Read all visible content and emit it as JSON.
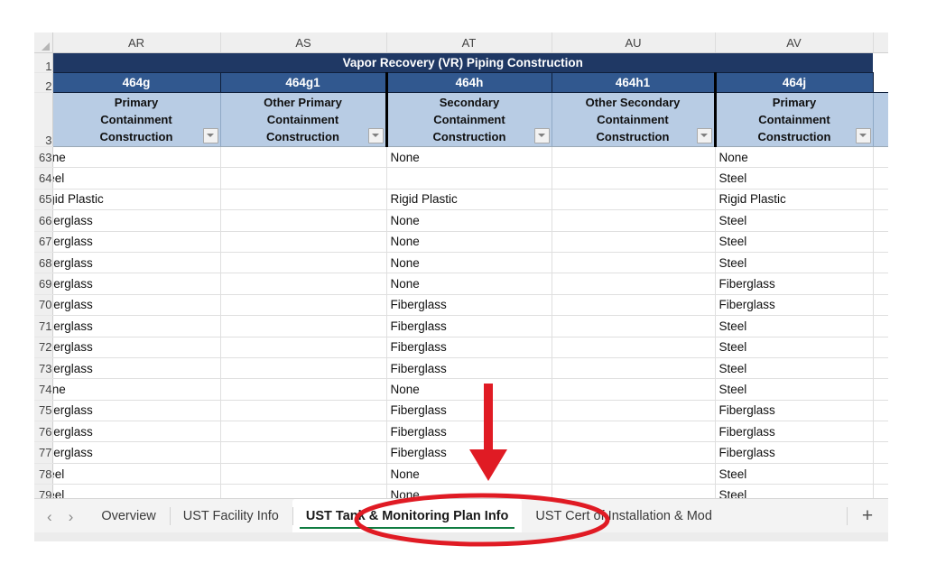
{
  "spreadsheet": {
    "corner_label": "select-all",
    "column_headers": [
      "AR",
      "AS",
      "AT",
      "AU",
      "AV"
    ],
    "title_row": {
      "row_number": "1",
      "text": "Vapor Recovery (VR) Piping Construction"
    },
    "code_row": {
      "row_number": "2",
      "codes": [
        "464g",
        "464g1",
        "464h",
        "464h1",
        "464j"
      ]
    },
    "label_row": {
      "row_number": "3",
      "labels": [
        [
          "Primary",
          "Containment",
          "Construction"
        ],
        [
          "Other Primary",
          "Containment",
          "Construction"
        ],
        [
          "Secondary",
          "Containment",
          "Construction"
        ],
        [
          "Other Secondary",
          "Containment",
          "Construction"
        ],
        [
          "Primary",
          "Containment",
          "Construction"
        ]
      ],
      "filter_icon": "filter-dropdown-icon"
    },
    "rows": [
      {
        "n": "63",
        "AR": "None",
        "AS": "",
        "AT": "None",
        "AU": "",
        "AV": "None"
      },
      {
        "n": "64",
        "AR": "Steel",
        "AS": "",
        "AT": "",
        "AU": "",
        "AV": "Steel"
      },
      {
        "n": "65",
        "AR": "Rigid Plastic",
        "AS": "",
        "AT": "Rigid Plastic",
        "AU": "",
        "AV": "Rigid Plastic"
      },
      {
        "n": "66",
        "AR": "Fiberglass",
        "AS": "",
        "AT": "None",
        "AU": "",
        "AV": "Steel"
      },
      {
        "n": "67",
        "AR": "Fiberglass",
        "AS": "",
        "AT": "None",
        "AU": "",
        "AV": "Steel"
      },
      {
        "n": "68",
        "AR": "Fiberglass",
        "AS": "",
        "AT": "None",
        "AU": "",
        "AV": "Steel"
      },
      {
        "n": "69",
        "AR": "Fiberglass",
        "AS": "",
        "AT": "None",
        "AU": "",
        "AV": "Fiberglass"
      },
      {
        "n": "70",
        "AR": "Fiberglass",
        "AS": "",
        "AT": "Fiberglass",
        "AU": "",
        "AV": "Fiberglass"
      },
      {
        "n": "71",
        "AR": "Fiberglass",
        "AS": "",
        "AT": "Fiberglass",
        "AU": "",
        "AV": "Steel"
      },
      {
        "n": "72",
        "AR": "Fiberglass",
        "AS": "",
        "AT": "Fiberglass",
        "AU": "",
        "AV": "Steel"
      },
      {
        "n": "73",
        "AR": "Fiberglass",
        "AS": "",
        "AT": "Fiberglass",
        "AU": "",
        "AV": "Steel"
      },
      {
        "n": "74",
        "AR": "None",
        "AS": "",
        "AT": "None",
        "AU": "",
        "AV": "Steel"
      },
      {
        "n": "75",
        "AR": "Fiberglass",
        "AS": "",
        "AT": "Fiberglass",
        "AU": "",
        "AV": "Fiberglass"
      },
      {
        "n": "76",
        "AR": "Fiberglass",
        "AS": "",
        "AT": "Fiberglass",
        "AU": "",
        "AV": "Fiberglass"
      },
      {
        "n": "77",
        "AR": "Fiberglass",
        "AS": "",
        "AT": "Fiberglass",
        "AU": "",
        "AV": "Fiberglass"
      },
      {
        "n": "78",
        "AR": "Steel",
        "AS": "",
        "AT": "None",
        "AU": "",
        "AV": "Steel"
      },
      {
        "n": "79",
        "AR": "Steel",
        "AS": "",
        "AT": "None",
        "AU": "",
        "AV": "Steel"
      }
    ]
  },
  "tabbar": {
    "prev_icon": "chevron-left-icon",
    "next_icon": "chevron-right-icon",
    "tabs": [
      {
        "label": "Overview",
        "active": false
      },
      {
        "label": "UST Facility Info",
        "active": false
      },
      {
        "label": "UST Tank & Monitoring Plan Info",
        "active": true
      },
      {
        "label": "UST Cert of Installation & Mod",
        "active": false
      }
    ],
    "add_sheet_label": "+",
    "active_tab_accent": "#107c41"
  },
  "annotations": {
    "arrow": {
      "name": "red-down-arrow",
      "color": "#e01b24"
    },
    "ellipse": {
      "name": "red-highlight-ellipse",
      "color": "#e01b24"
    }
  }
}
